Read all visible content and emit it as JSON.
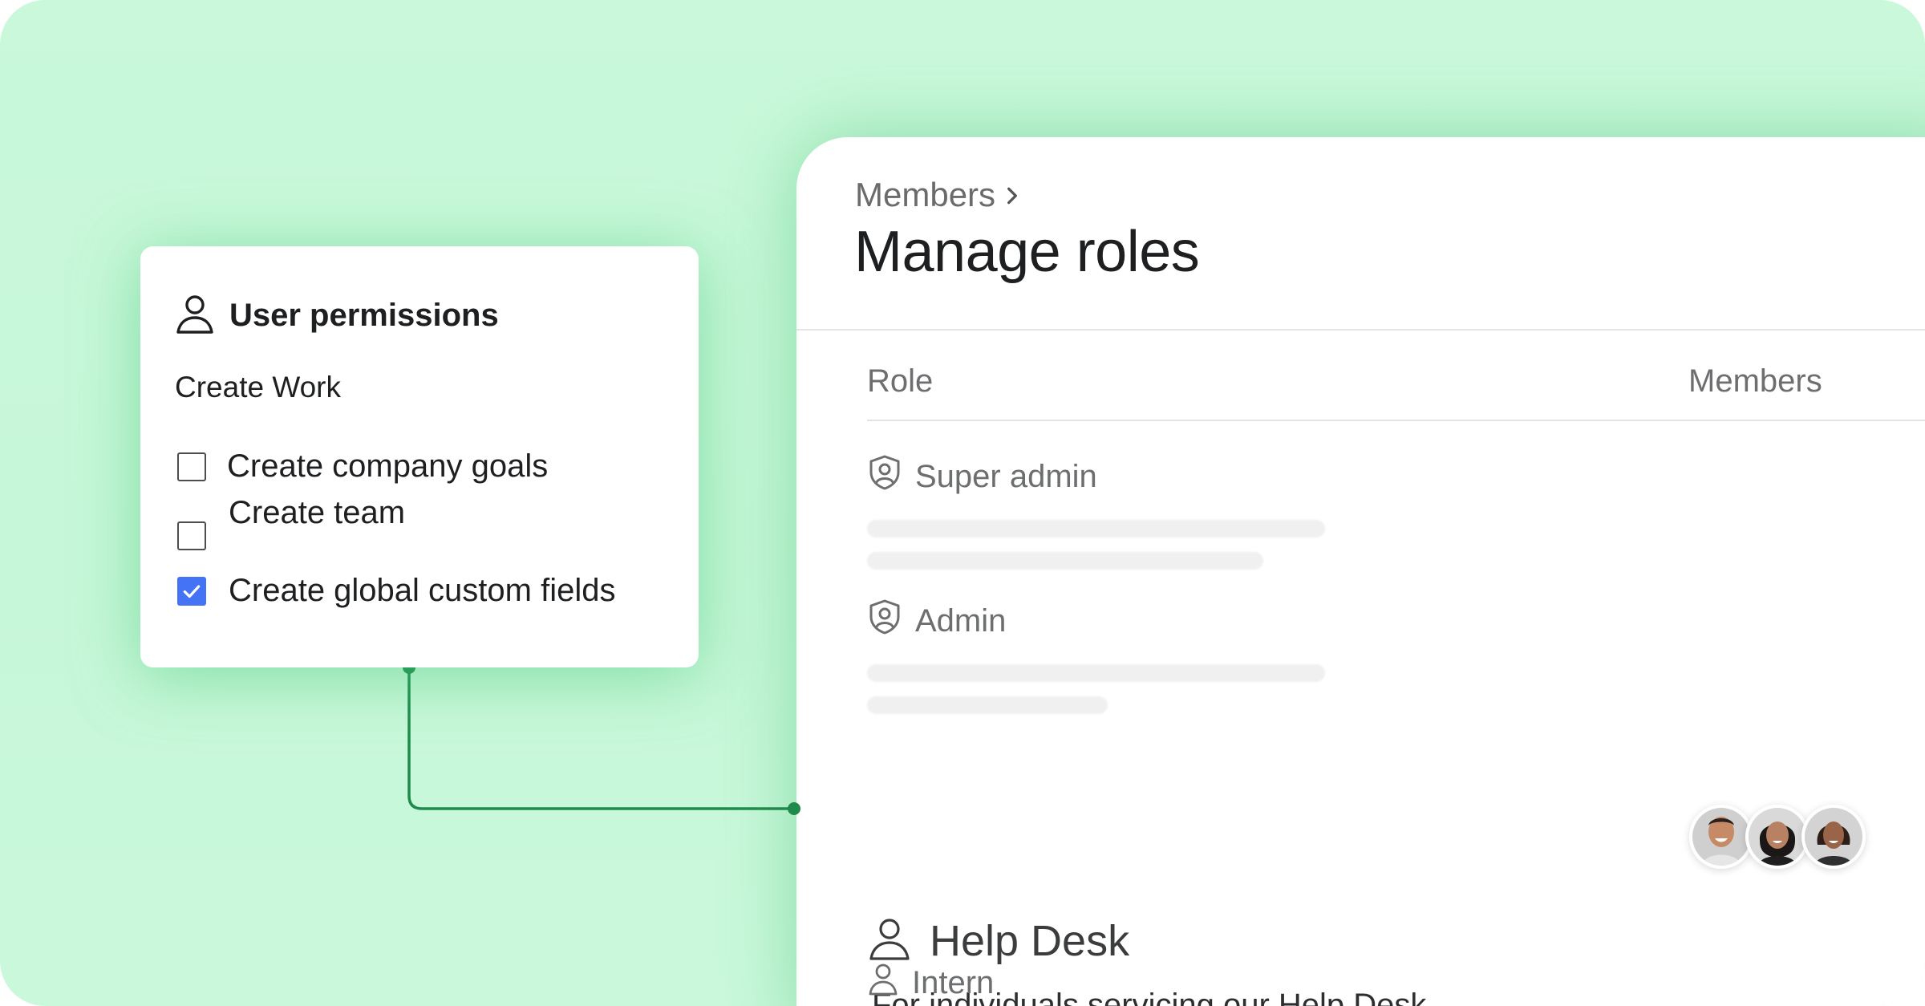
{
  "roles_panel": {
    "breadcrumb": "Members",
    "title": "Manage roles",
    "columns": {
      "role": "Role",
      "members": "Members"
    },
    "roles": [
      {
        "name": "Super admin",
        "icon": "shield-user-icon"
      },
      {
        "name": "Admin",
        "icon": "shield-user-icon"
      },
      {
        "name": "Help Desk",
        "icon": "user-icon",
        "description": "For individuals servicing our Help Desk",
        "member_avatars": 3
      },
      {
        "name": "Intern",
        "icon": "user-icon"
      }
    ]
  },
  "permissions_card": {
    "title": "User permissions",
    "section": "Create Work",
    "items": [
      {
        "label": "Create company goals",
        "checked": false
      },
      {
        "label": "Create team",
        "checked": false
      },
      {
        "label": "Create global custom fields",
        "checked": true
      }
    ]
  },
  "colors": {
    "background": "#c9f8da",
    "connector": "#1f8a4c",
    "checkbox_checked": "#4573f5"
  }
}
